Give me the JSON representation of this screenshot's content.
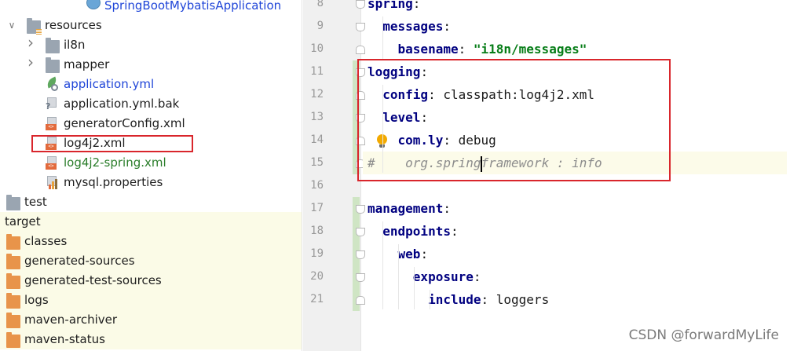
{
  "tree": {
    "items": [
      {
        "label": "SpringBootMybatisApplication",
        "icon": "spring-boot-class-icon",
        "color": "blue"
      },
      {
        "label": "resources",
        "icon": "resources-folder-icon",
        "expanded": true
      },
      {
        "label": "il8n",
        "icon": "folder-icon",
        "expanded": false
      },
      {
        "label": "mapper",
        "icon": "folder-icon",
        "expanded": false
      },
      {
        "label": "application.yml",
        "icon": "spring-config-file-icon",
        "color": "blue"
      },
      {
        "label": "application.yml.bak",
        "icon": "unknown-file-icon"
      },
      {
        "label": "generatorConfig.xml",
        "icon": "xml-file-icon"
      },
      {
        "label": "log4j2.xml",
        "icon": "xml-file-icon",
        "highlighted": true
      },
      {
        "label": "log4j2-spring.xml",
        "icon": "xml-file-icon",
        "color": "green"
      },
      {
        "label": "mysql.properties",
        "icon": "properties-file-icon"
      },
      {
        "label": "test",
        "icon": "folder-icon"
      },
      {
        "label": "target",
        "icon": "excluded-folder-icon",
        "excluded": true
      },
      {
        "label": "classes",
        "icon": "excluded-folder-icon",
        "excluded": true
      },
      {
        "label": "generated-sources",
        "icon": "excluded-folder-icon",
        "excluded": true
      },
      {
        "label": "generated-test-sources",
        "icon": "excluded-folder-icon",
        "excluded": true
      },
      {
        "label": "logs",
        "icon": "excluded-folder-icon",
        "excluded": true
      },
      {
        "label": "maven-archiver",
        "icon": "excluded-folder-icon",
        "excluded": true
      },
      {
        "label": "maven-status",
        "icon": "excluded-folder-icon",
        "excluded": true
      }
    ]
  },
  "editor": {
    "current_line": 15,
    "lines": [
      {
        "num": "8",
        "tokens": [
          {
            "t": "spring",
            "c": "k"
          },
          {
            "t": ":",
            "c": ""
          }
        ]
      },
      {
        "num": "9",
        "tokens": [
          {
            "t": "  ",
            "c": ""
          },
          {
            "t": "messages",
            "c": "k"
          },
          {
            "t": ":",
            "c": ""
          }
        ]
      },
      {
        "num": "10",
        "tokens": [
          {
            "t": "    ",
            "c": ""
          },
          {
            "t": "basename",
            "c": "k"
          },
          {
            "t": ": ",
            "c": ""
          },
          {
            "t": "\"i18n/messages\"",
            "c": "s"
          }
        ]
      },
      {
        "num": "11",
        "tokens": [
          {
            "t": "logging",
            "c": "k"
          },
          {
            "t": ":",
            "c": ""
          }
        ]
      },
      {
        "num": "12",
        "tokens": [
          {
            "t": "  ",
            "c": ""
          },
          {
            "t": "config",
            "c": "k"
          },
          {
            "t": ": classpath:log4j2.xml",
            "c": ""
          }
        ]
      },
      {
        "num": "13",
        "tokens": [
          {
            "t": "  ",
            "c": ""
          },
          {
            "t": "level",
            "c": "k"
          },
          {
            "t": ":",
            "c": ""
          }
        ]
      },
      {
        "num": "14",
        "tokens": [
          {
            "t": "    ",
            "c": ""
          },
          {
            "t": "com.ly",
            "c": "k"
          },
          {
            "t": ": debug",
            "c": ""
          }
        ]
      },
      {
        "num": "15",
        "tokens": [
          {
            "t": "#    org.spring",
            "c": "cmt"
          },
          {
            "t": "|",
            "c": "caret"
          },
          {
            "t": "framework : info",
            "c": "cmt"
          }
        ]
      },
      {
        "num": "16",
        "tokens": []
      },
      {
        "num": "17",
        "tokens": [
          {
            "t": "management",
            "c": "k"
          },
          {
            "t": ":",
            "c": ""
          }
        ]
      },
      {
        "num": "18",
        "tokens": [
          {
            "t": "  ",
            "c": ""
          },
          {
            "t": "endpoints",
            "c": "k"
          },
          {
            "t": ":",
            "c": ""
          }
        ]
      },
      {
        "num": "19",
        "tokens": [
          {
            "t": "    ",
            "c": ""
          },
          {
            "t": "web",
            "c": "k"
          },
          {
            "t": ":",
            "c": ""
          }
        ]
      },
      {
        "num": "20",
        "tokens": [
          {
            "t": "      ",
            "c": ""
          },
          {
            "t": "exposure",
            "c": "k"
          },
          {
            "t": ":",
            "c": ""
          }
        ]
      },
      {
        "num": "21",
        "tokens": [
          {
            "t": "        ",
            "c": ""
          },
          {
            "t": "include",
            "c": "k"
          },
          {
            "t": ": loggers",
            "c": ""
          }
        ]
      }
    ]
  },
  "watermark": "CSDN @forwardMyLife",
  "colors": {
    "highlight_box": "#d9262c",
    "yaml_key": "#000080",
    "yaml_string": "#067d17",
    "comment": "#8c8c8c",
    "excluded_bg": "#fbfbe7"
  }
}
